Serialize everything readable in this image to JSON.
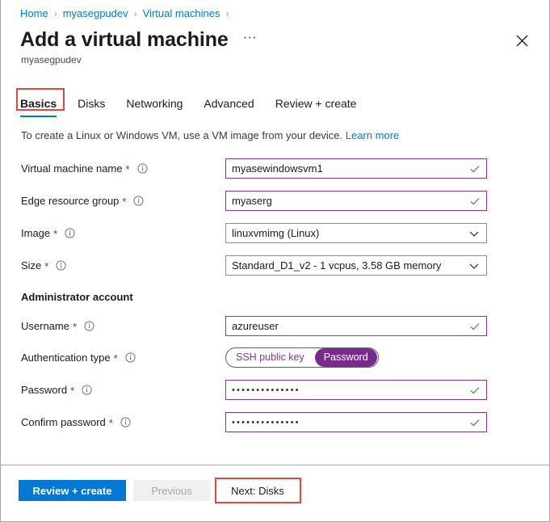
{
  "breadcrumb": {
    "items": [
      "Home",
      "myasegpudev",
      "Virtual machines"
    ],
    "separator": "›"
  },
  "header": {
    "title": "Add a virtual machine",
    "subtitle": "myasegpudev",
    "more_label": "⋯",
    "close_icon": "close-icon"
  },
  "tabs": {
    "items": [
      {
        "label": "Basics",
        "active": true
      },
      {
        "label": "Disks",
        "active": false
      },
      {
        "label": "Networking",
        "active": false
      },
      {
        "label": "Advanced",
        "active": false
      },
      {
        "label": "Review + create",
        "active": false
      }
    ]
  },
  "description": {
    "text": "To create a Linux or Windows VM, use a VM image from your device.",
    "link": "Learn more"
  },
  "fields": {
    "vm_name": {
      "label": "Virtual machine name",
      "required": "*",
      "value": "myasewindowsvm1",
      "type": "text",
      "valid": true
    },
    "edge_resource_group": {
      "label": "Edge resource group",
      "required": "*",
      "value": "myaserg",
      "type": "text",
      "valid": true
    },
    "image": {
      "label": "Image",
      "required": "*",
      "value": "linuxvmimg (Linux)",
      "type": "select"
    },
    "size": {
      "label": "Size",
      "required": "*",
      "value": "Standard_D1_v2 - 1 vcpus, 3.58 GB memory",
      "type": "select"
    },
    "username": {
      "label": "Username",
      "required": "*",
      "value": "azureuser",
      "type": "text",
      "valid": true
    },
    "auth_type": {
      "label": "Authentication type",
      "required": "*",
      "options": [
        "SSH public key",
        "Password"
      ],
      "selected": "Password"
    },
    "password": {
      "label": "Password",
      "required": "*",
      "value": "••••••••••••••",
      "type": "password",
      "valid": true
    },
    "confirm_password": {
      "label": "Confirm password",
      "required": "*",
      "value": "••••••••••••••",
      "type": "password",
      "valid": true
    }
  },
  "sections": {
    "administrator_account": "Administrator account"
  },
  "footer": {
    "review_create": "Review + create",
    "previous": "Previous",
    "next": "Next: Disks"
  },
  "colors": {
    "accent_blue": "#0078d4",
    "link_blue": "#0078d4",
    "purple_border": "#8a3391",
    "purple_fill": "#7a2a8f",
    "required_red": "#a4262c",
    "highlight_red": "#e8453c",
    "valid_green": "#4b9b3f"
  }
}
